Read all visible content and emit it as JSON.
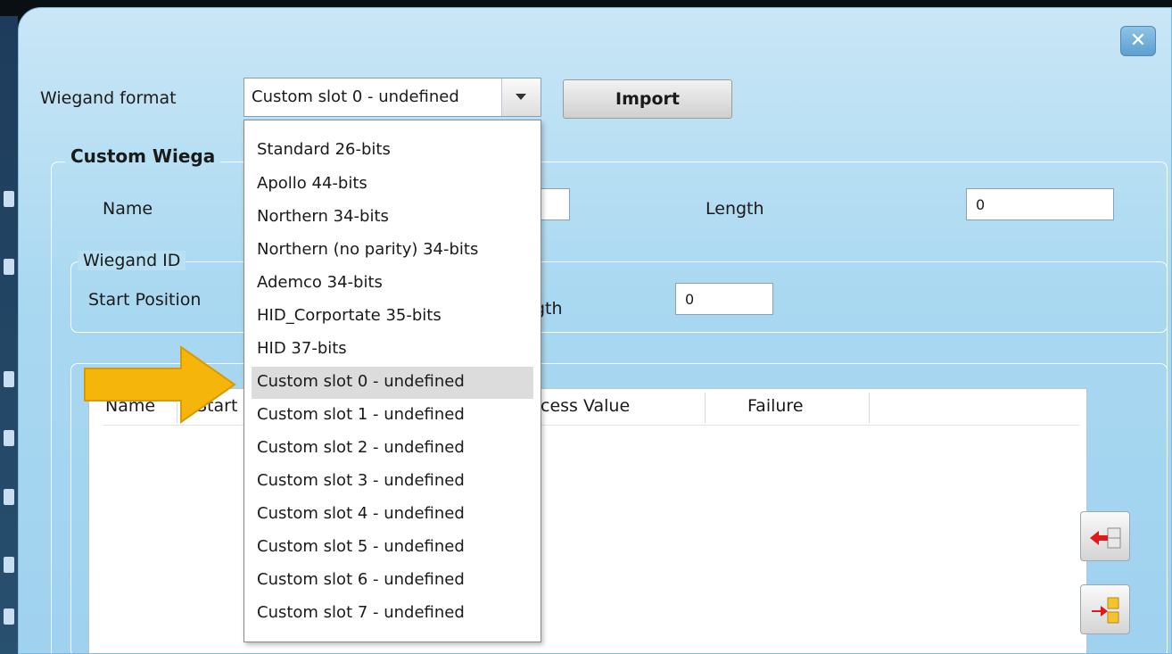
{
  "dialog": {
    "close_glyph": "✕",
    "wiegand_format_label": "Wiegand format",
    "combo_value": "Custom slot 0 - undefined",
    "import_label": "Import",
    "custom_group_title": "Custom Wiega",
    "name_label": "Name",
    "length_label": "Length",
    "length_value": "0",
    "wiegand_id_title": "Wiegand ID",
    "start_position_label": "Start Position",
    "id_length_label_visible": "gth",
    "id_length_value": "0",
    "table_headers": {
      "name": "Name",
      "start": "Start",
      "success_value": "cess Value",
      "failure": "Failure"
    }
  },
  "dropdown": {
    "items": [
      "Standard 26-bits",
      "Apollo 44-bits",
      "Northern 34-bits",
      "Northern (no parity) 34-bits",
      "Ademco 34-bits",
      "HID_Corportate 35-bits",
      "HID 37-bits",
      "Custom slot 0 - undefined",
      "Custom slot 1 - undefined",
      "Custom slot 2 - undefined",
      "Custom slot 3 - undefined",
      "Custom slot 4 - undefined",
      "Custom slot 5 - undefined",
      "Custom slot 6 - undefined",
      "Custom slot 7 - undefined"
    ],
    "selected": "Custom slot 0 - undefined"
  },
  "colors": {
    "arrow": "#f5b50a",
    "dialog_bg": "#a9d8f1"
  },
  "icons": {
    "close": "close-icon",
    "combo_arrow": "chevron-down-icon",
    "side_button_1": "move-left-arrow-icon",
    "side_button_2": "import-blocks-icon",
    "annotation": "pointer-arrow-annotation"
  }
}
